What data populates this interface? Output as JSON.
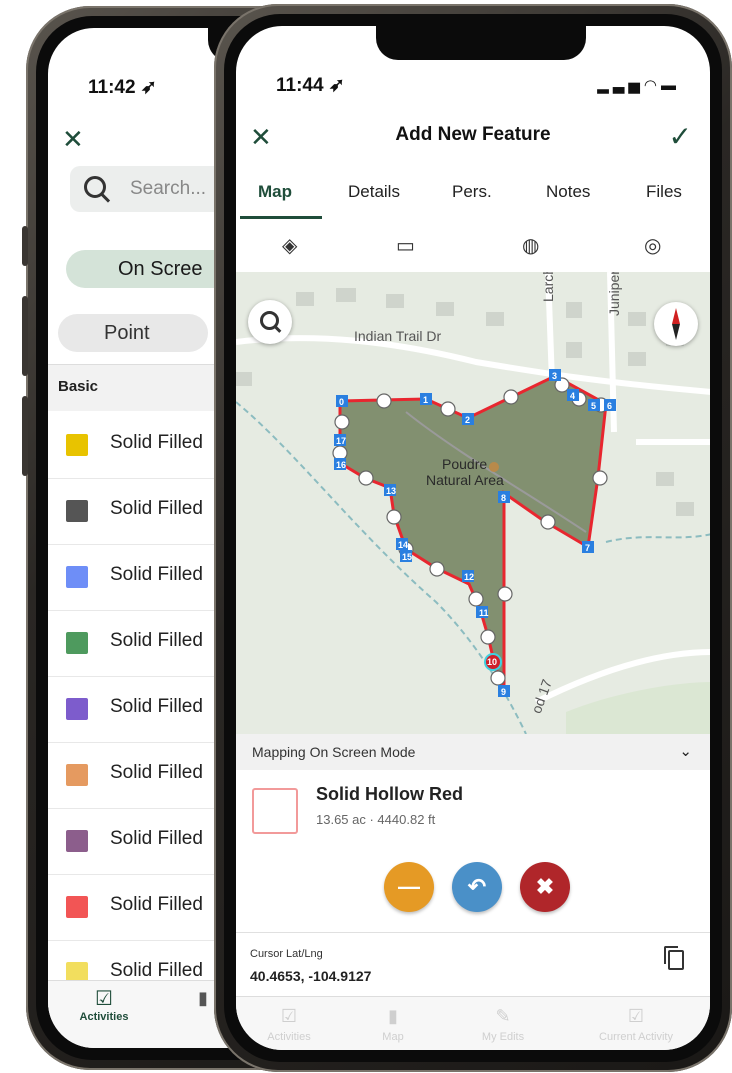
{
  "back_phone": {
    "time": "11:42 ➶",
    "search_placeholder": "Search...",
    "filter_on_screen": "On Scree",
    "filter_point": "Point",
    "section_title": "Basic",
    "symbols": [
      {
        "label": "Solid Filled",
        "color": "#e8c300"
      },
      {
        "label": "Solid Filled",
        "color": "#555555"
      },
      {
        "label": "Solid Filled",
        "color": "#6e8ef7"
      },
      {
        "label": "Solid Filled",
        "color": "#4e9a5e"
      },
      {
        "label": "Solid Filled",
        "color": "#7d5ccc"
      },
      {
        "label": "Solid Filled",
        "color": "#e59a60"
      },
      {
        "label": "Solid Filled",
        "color": "#8c5e8c"
      },
      {
        "label": "Solid Filled",
        "color": "#f25555"
      },
      {
        "label": "Solid Filled",
        "color": "#f2de5e"
      }
    ],
    "tab_activities": "Activities",
    "tab_map": "Ma"
  },
  "front_phone": {
    "time": "11:44 ➶",
    "title": "Add New Feature",
    "tabs": [
      "Map",
      "Details",
      "Pers.",
      "Notes",
      "Files"
    ],
    "active_tab": "Map",
    "map_labels": {
      "street_indian_trail": "Indian Trail Dr",
      "street_larch": "Larch Dr",
      "street_juniper": "Juniper",
      "area_name_1": "Poudre",
      "area_name_2": "Natural Area",
      "road": "od 17"
    },
    "vertex_labels": [
      "0",
      "1",
      "2",
      "3",
      "4",
      "5",
      "6",
      "7",
      "8",
      "9",
      "10",
      "11",
      "12",
      "13",
      "14",
      "15",
      "16",
      "17"
    ],
    "mode_title": "Mapping On Screen Mode",
    "feature_name": "Solid Hollow Red",
    "feature_meta": "13.65 ac · 4440.82 ft",
    "cursor_label": "Cursor Lat/Lng",
    "cursor_value": "40.4653, -104.9127",
    "bottom_tabs": [
      "Activities",
      "Map",
      "My Edits",
      "Current Activity"
    ],
    "colors": {
      "accent": "#1f4d3a",
      "polygon_fill": "#6b7b57",
      "polygon_stroke": "#e8262f",
      "btn_remove": "#e59a25",
      "btn_undo": "#4a90c8",
      "btn_delete": "#b0262a"
    }
  }
}
